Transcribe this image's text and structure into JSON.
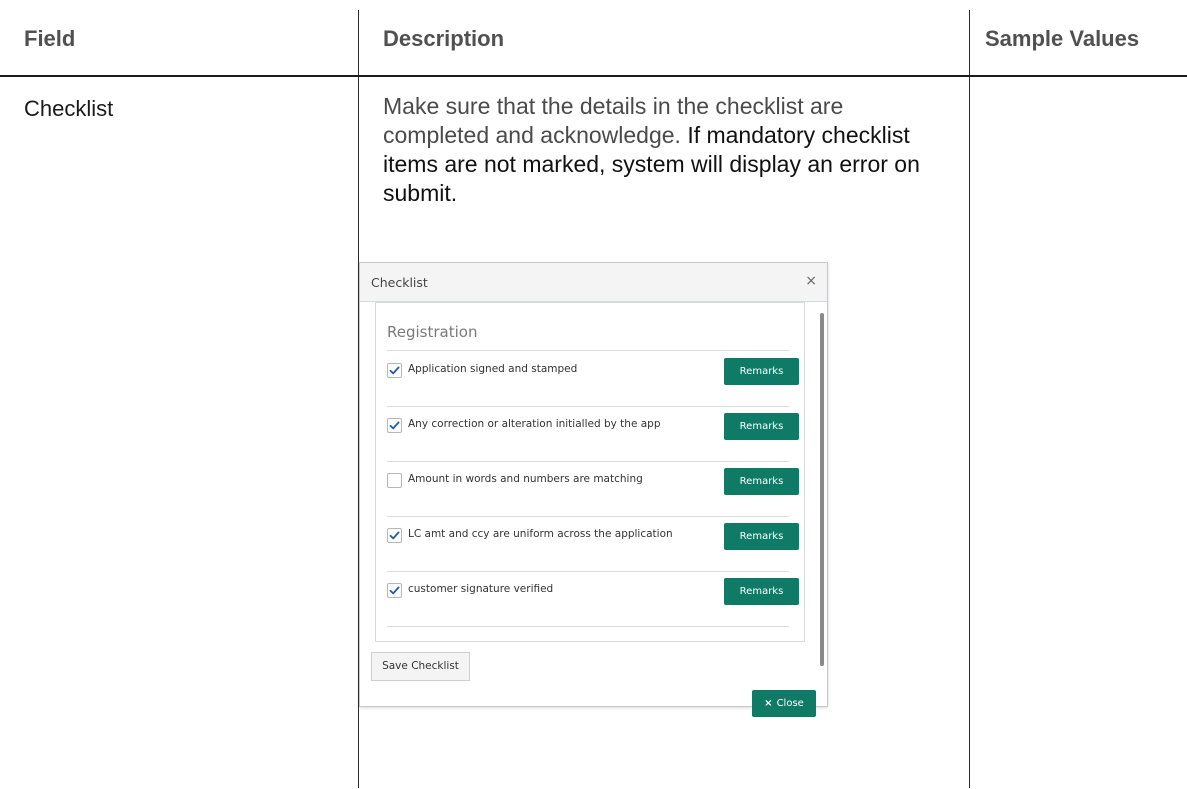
{
  "table": {
    "headers": [
      "Field",
      "Description",
      "Sample Values"
    ],
    "row": {
      "field": "Checklist",
      "description_part1": "Make sure that the details in the checklist are completed and acknowledge. ",
      "description_part2": "If mandatory checklist items are not marked, system will display an error on submit."
    }
  },
  "dialog": {
    "title": "Checklist",
    "close_icon": "×",
    "section_title": "Registration",
    "items": [
      {
        "label": "Application signed and stamped",
        "checked": true,
        "button": "Remarks"
      },
      {
        "label": "Any correction or alteration initialled by the  app",
        "checked": true,
        "button": "Remarks"
      },
      {
        "label": "Amount in words and numbers are matching",
        "checked": false,
        "button": "Remarks"
      },
      {
        "label": "LC amt and ccy are uniform across the application",
        "checked": true,
        "button": "Remarks"
      },
      {
        "label": "customer signature verified",
        "checked": true,
        "button": "Remarks"
      }
    ],
    "save_label": "Save Checklist",
    "close_glyph": "×",
    "close_label": "Close",
    "colors": {
      "button_bg": "#0f7a66",
      "check": "#1f5fa8"
    },
    "icons": {
      "check": "checkmark-icon",
      "dismiss": "close-icon"
    }
  }
}
